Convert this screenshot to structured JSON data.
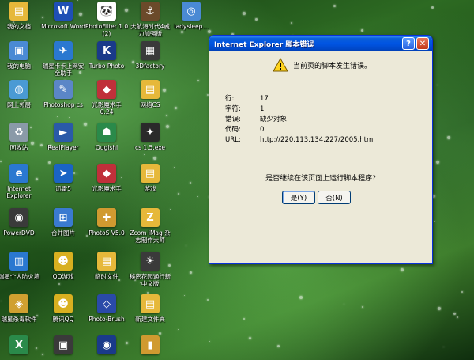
{
  "desktop_icons": [
    {
      "name": "my-documents",
      "label": "我的文档",
      "color": "#e6b83a",
      "glyph": "▤"
    },
    {
      "name": "ms-word",
      "label": "Microsoft Word",
      "color": "#1f4fb5",
      "glyph": "W"
    },
    {
      "name": "photofilter",
      "label": "PhotoFilter 1.0 (2)",
      "color": "#ffffff",
      "glyph": "🐼"
    },
    {
      "name": "dahanghai",
      "label": "大航海时代4威力加强版",
      "color": "#6b4a2a",
      "glyph": "⚓"
    },
    {
      "name": "ladysleep",
      "label": "ladysleep...",
      "color": "#4a8ad4",
      "glyph": "◎"
    },
    {
      "name": "my-computer",
      "label": "我的电脑",
      "color": "#4a8ad4",
      "glyph": "▣"
    },
    {
      "name": "ruixing-card",
      "label": "瑞星卡卡上网安全助手",
      "color": "#2a78d0",
      "glyph": "✈"
    },
    {
      "name": "turbo-photo",
      "label": "Turbo Photo",
      "color": "#1a3a8a",
      "glyph": "K"
    },
    {
      "name": "3dfactory",
      "label": "3Dfactory",
      "color": "#3a3a3a",
      "glyph": "▦"
    },
    {
      "name": "network",
      "label": "网上邻居",
      "color": "#4a9ad4",
      "glyph": "◍"
    },
    {
      "name": "photoshop-cs",
      "label": "Photoshop cs",
      "color": "#5b86c7",
      "glyph": "✎"
    },
    {
      "name": "guangying-024",
      "label": "光影魔术手 0.24",
      "color": "#c0303a",
      "glyph": "◆"
    },
    {
      "name": "wangluo-cs",
      "label": "网络CS",
      "color": "#e6b83a",
      "glyph": "▤"
    },
    {
      "name": "recycle-bin",
      "label": "回收站",
      "color": "#8a9aa8",
      "glyph": "♻"
    },
    {
      "name": "realplayer",
      "label": "RealPlayer",
      "color": "#2a5aa8",
      "glyph": "►"
    },
    {
      "name": "ougishi",
      "label": "Ougishi",
      "color": "#2a8a4a",
      "glyph": "☗"
    },
    {
      "name": "cs15",
      "label": "cs 1.5.exe",
      "color": "#2a2a2a",
      "glyph": "✦"
    },
    {
      "name": "internet-explorer",
      "label": "Internet Explorer",
      "color": "#2a78d0",
      "glyph": "e"
    },
    {
      "name": "xunlei",
      "label": "迅雷5",
      "color": "#1a64c4",
      "glyph": "➤"
    },
    {
      "name": "guangying",
      "label": "光影魔术手",
      "color": "#c0303a",
      "glyph": "◆"
    },
    {
      "name": "youxi",
      "label": "游戏",
      "color": "#e6b83a",
      "glyph": "▤"
    },
    {
      "name": "powerdvd",
      "label": "PowerDVD",
      "color": "#3a3a3a",
      "glyph": "◉"
    },
    {
      "name": "hebing-tupian",
      "label": "合并图片",
      "color": "#3a7ad0",
      "glyph": "⊞"
    },
    {
      "name": "photo-v5",
      "label": "PhotoS V5.0",
      "color": "#d09a30",
      "glyph": "✚"
    },
    {
      "name": "zcom-imag",
      "label": "Zcom iMag 杂志制作大师",
      "color": "#e6b83a",
      "glyph": "Z"
    },
    {
      "name": "ruixing-firewall",
      "label": "瑞星个人防火墙",
      "color": "#2a78d0",
      "glyph": "▥"
    },
    {
      "name": "qq-game",
      "label": "QQ游戏",
      "color": "#d8b020",
      "glyph": "☻"
    },
    {
      "name": "linshi-wenjian",
      "label": "临时文件",
      "color": "#e6b83a",
      "glyph": "▤"
    },
    {
      "name": "mimi-huayuan",
      "label": "秘密花园通行新中文版",
      "color": "#3a3a3a",
      "glyph": "☀"
    },
    {
      "name": "ruixing-antivirus",
      "label": "瑞星杀毒软件",
      "color": "#d0a030",
      "glyph": "◈"
    },
    {
      "name": "tencent-qq",
      "label": "腾讯QQ",
      "color": "#d8b020",
      "glyph": "☻"
    },
    {
      "name": "photo-brush",
      "label": "Photo-Brush",
      "color": "#2a4aa8",
      "glyph": "◇"
    },
    {
      "name": "new-folder",
      "label": "新建文件夹",
      "color": "#e6b83a",
      "glyph": "▤"
    },
    {
      "name": "excel",
      "label": "",
      "color": "#2a8a4a",
      "glyph": "X"
    },
    {
      "name": "icon-r8-2",
      "label": "",
      "color": "#3a3a3a",
      "glyph": "▣"
    },
    {
      "name": "icon-r8-3",
      "label": "",
      "color": "#1a3a8a",
      "glyph": "◉"
    },
    {
      "name": "icon-r8-4",
      "label": "",
      "color": "#d09a30",
      "glyph": "▮"
    }
  ],
  "dialog": {
    "title": "Internet Explorer 脚本错误",
    "help_glyph": "?",
    "close_glyph": "✕",
    "headline": "当前页的脚本发生错误。",
    "details": [
      {
        "key": "行:",
        "value": "17"
      },
      {
        "key": "字符:",
        "value": "1"
      },
      {
        "key": "错误:",
        "value": "缺少对象"
      },
      {
        "key": "代码:",
        "value": "0"
      },
      {
        "key": "URL:",
        "value": "http://220.113.134.227/2005.htm"
      }
    ],
    "question": "是否继续在该页面上运行脚本程序?",
    "yes_label": "是(Y)",
    "no_label": "否(N)"
  }
}
